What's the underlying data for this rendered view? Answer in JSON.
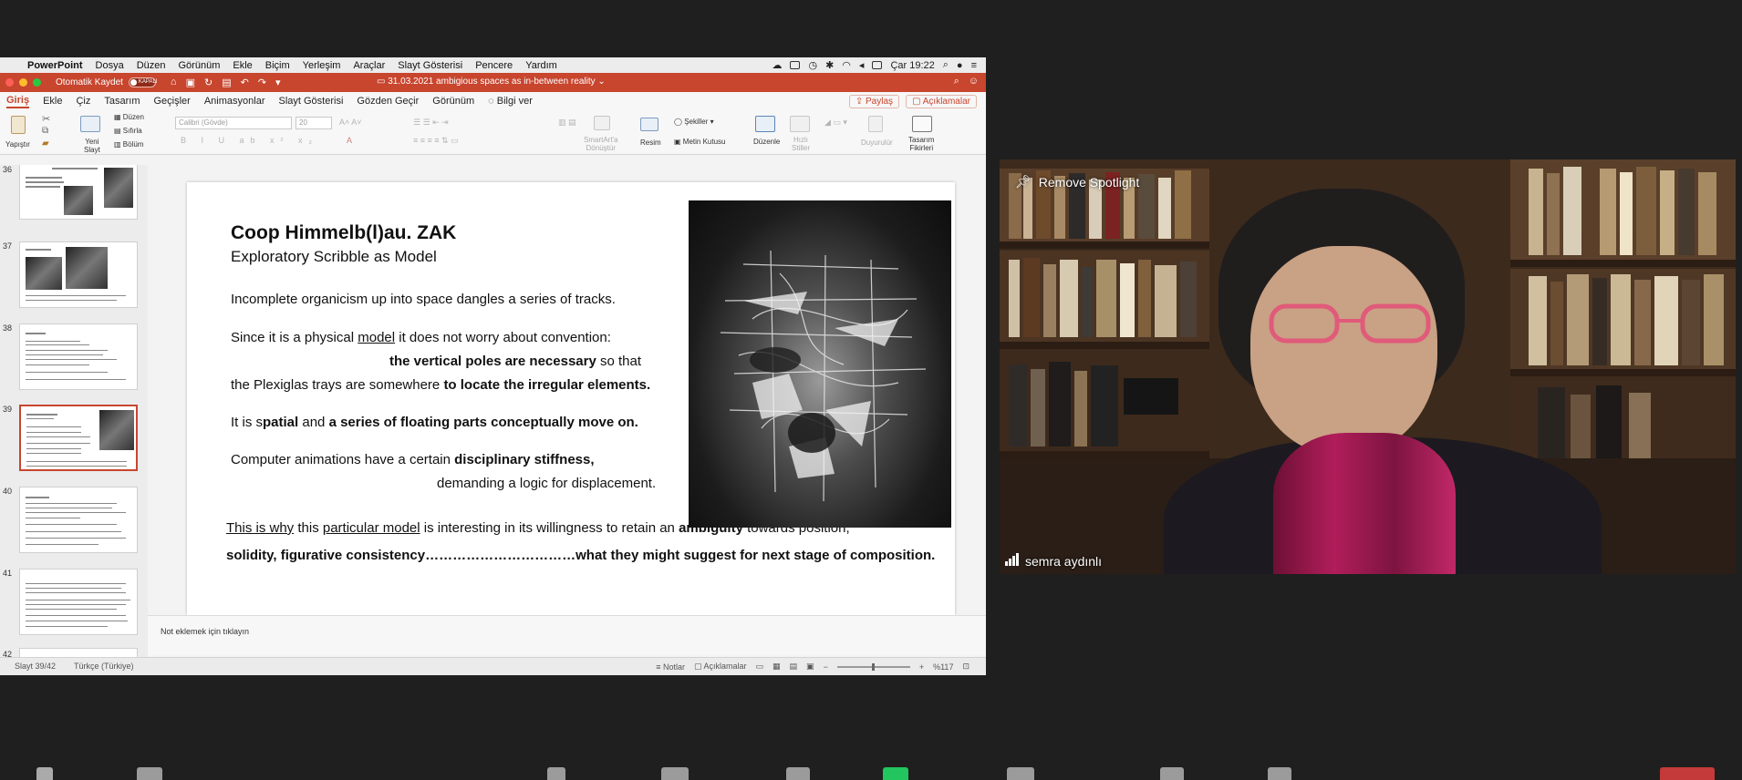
{
  "menubar": {
    "app": "PowerPoint",
    "items": [
      "Dosya",
      "Düzen",
      "Görünüm",
      "Ekle",
      "Biçim",
      "Yerleşim",
      "Araçlar",
      "Slayt Gösterisi",
      "Pencere",
      "Yardım"
    ],
    "clock": "Çar 19:22"
  },
  "titlebar": {
    "autosave_label": "Otomatik Kaydet",
    "toggle_label": "KAPALI",
    "doc_title": "31.03.2021 ambigious spaces as in-between reality"
  },
  "ribbon_tabs": {
    "tabs": [
      "Giriş",
      "Ekle",
      "Çiz",
      "Tasarım",
      "Geçişler",
      "Animasyonlar",
      "Slayt Gösterisi",
      "Gözden Geçir",
      "Görünüm"
    ],
    "tell_me": "Bilgi ver",
    "share": "Paylaş",
    "comments": "Açıklamalar"
  },
  "ribbon": {
    "paste": "Yapıştır",
    "new_slide": "Yeni",
    "new_slide_2": "Slayt",
    "layout": "Düzen",
    "reset": "Sıfırla",
    "section": "Bölüm",
    "font_name": "Calibri (Gövde)",
    "font_size": "20",
    "smartart": "SmartArt'a",
    "smartart_2": "Dönüştür",
    "picture": "Resim",
    "shapes": "Şekiller",
    "textbox": "Metin Kutusu",
    "arrange": "Düzenle",
    "quick_styles": "Hızlı",
    "quick_styles_2": "Stiller",
    "dictate": "Duyurulür",
    "designer": "Tasarım",
    "designer_2": "Fikirleri"
  },
  "thumbnails": {
    "numbers": [
      "36",
      "37",
      "38",
      "39",
      "40",
      "41",
      "42"
    ],
    "selected": "39"
  },
  "slide": {
    "title": "Coop Himmelb(l)au.  ZAK",
    "subtitle": "Exploratory Scribble as Model",
    "line1": "Incomplete organicism up into space dangles a series of tracks.",
    "line2_a": "Since it is a physical ",
    "line2_b": "model",
    "line2_c": " it does not worry about convention:",
    "line3_a": "the vertical poles are necessary",
    "line3_b": " so that",
    "line4_a": "the Plexiglas trays are somewhere ",
    "line4_b": "to locate the irregular elements.",
    "line5_a": "It is s",
    "line5_b": "patial",
    "line5_c": " and ",
    "line5_d": "a series of floating parts conceptually move on.",
    "line6_a": "Computer animations have a certain ",
    "line6_b": "disciplinary stiffness,",
    "line7": "demanding a logic for displacement.",
    "line8_a": "This is why",
    "line8_b": " this ",
    "line8_c": "particular model",
    "line8_d": " is interesting in its willingness to retain an ",
    "line8_e": "ambiguity",
    "line8_f": " towards position,",
    "line9": "solidity, figurative consistency……………………………what they might suggest for next stage of composition."
  },
  "notes": {
    "placeholder": "Not eklemek için tıklayın"
  },
  "statusbar": {
    "slide_count": "Slayt 39/42",
    "language": "Türkçe (Türkiye)",
    "notes_btn": "Notlar",
    "comments_btn": "Açıklamalar",
    "zoom": "%117"
  },
  "video": {
    "spotlight": "Remove Spotlight",
    "participant": "semra aydınlı"
  },
  "colors": {
    "accent": "#c8452e",
    "video_bg": "#4a3422"
  }
}
